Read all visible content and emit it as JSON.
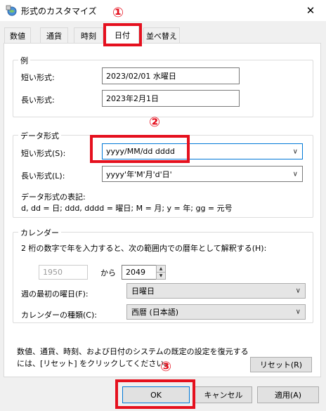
{
  "window": {
    "title": "形式のカスタマイズ",
    "close_glyph": "✕"
  },
  "tabs": [
    {
      "label": "数値"
    },
    {
      "label": "通貨"
    },
    {
      "label": "時刻"
    },
    {
      "label": "日付"
    },
    {
      "label": "並べ替え"
    }
  ],
  "example_group": {
    "title": "例",
    "short_label": "短い形式:",
    "short_value": "2023/02/01 水曜日",
    "long_label": "長い形式:",
    "long_value": "2023年2月1日"
  },
  "date_format_group": {
    "title": "データ形式",
    "short_label": "短い形式(S):",
    "short_value": "yyyy/MM/dd dddd",
    "long_label": "長い形式(L):",
    "long_value": "yyyy'年'M'月'd'日'",
    "notation_title": "データ形式の表記:",
    "notation_text": "d, dd = 日;  ddd, dddd = 曜日; M = 月; y = 年; gg = 元号"
  },
  "calendar_group": {
    "title": "カレンダー",
    "description": "2 桁の数字で年を入力すると、次の範囲内での暦年として解釈する(H):",
    "year_from": "1950",
    "from_label": "から",
    "year_to": "2049",
    "first_day_label": "週の最初の曜日(F):",
    "first_day_value": "日曜日",
    "calendar_type_label": "カレンダーの種類(C):",
    "calendar_type_value": "西暦 (日本語)"
  },
  "reset": {
    "text_line1": "数値、通貨、時刻、および日付のシステムの既定の設定を復元する",
    "text_line2": "には、[リセット] をクリックしてください。",
    "button": "リセット(R)"
  },
  "buttons": {
    "ok": "OK",
    "cancel": "キャンセル",
    "apply": "適用(A)"
  },
  "annotations": {
    "step1": "①",
    "step2": "②",
    "step3": "③",
    "color": "#e5101e"
  }
}
